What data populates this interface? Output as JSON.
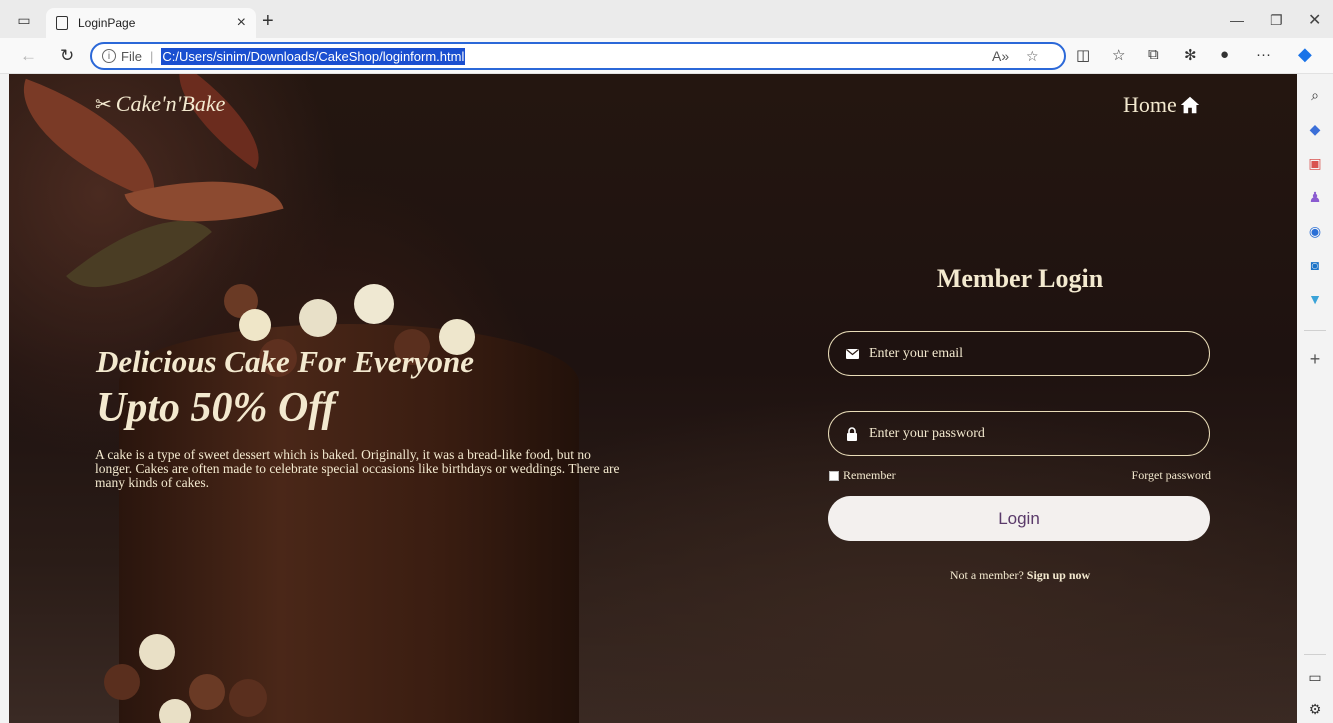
{
  "browser": {
    "tab_title": "LoginPage",
    "new_tab_glyph": "+",
    "close_tab_glyph": "×",
    "file_label": "File",
    "url": "C:/Users/sinim/Downloads/CakeShop/loginform.html",
    "more_glyph": "···"
  },
  "page": {
    "logo_text": "Cake'n'Bake",
    "home_label": "Home",
    "hero": {
      "line1": "Delicious Cake For Everyone",
      "line2": "Upto 50% Off",
      "description": "A cake is a type of sweet dessert which is baked. Originally, it was a bread-like food, but no longer. Cakes are often made to celebrate special occasions like birthdays or weddings. There are many kinds of cakes."
    },
    "login": {
      "title": "Member Login",
      "email_placeholder": "Enter your email",
      "password_placeholder": "Enter your password",
      "remember_label": "Remember",
      "forget_label": "Forget password",
      "login_button": "Login",
      "not_member_text": "Not a member?",
      "signup_link": "Sign up now"
    }
  },
  "colors": {
    "text_cream": "#f3e9cf",
    "url_highlight": "#1a4fd0",
    "button_text": "#5a3a6a"
  }
}
